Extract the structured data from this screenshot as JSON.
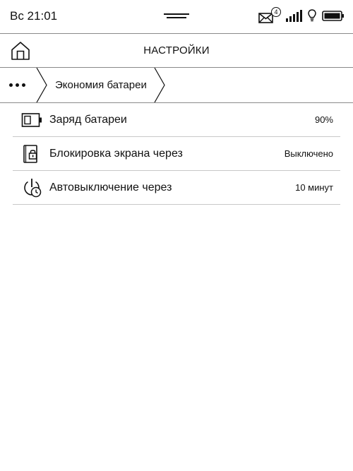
{
  "status_bar": {
    "time": "Вс 21:01",
    "mail_badge": "4",
    "icons": [
      "mail-icon",
      "signal-icon",
      "bulb-icon",
      "battery-icon"
    ]
  },
  "header": {
    "title": "НАСТРОЙКИ",
    "home_icon": "home-icon"
  },
  "breadcrumb": {
    "more_icon": "more-dots-icon",
    "current": "Экономия батареи"
  },
  "settings": [
    {
      "icon": "battery-icon",
      "label": "Заряд батареи",
      "value": "90%"
    },
    {
      "icon": "lock-screen-icon",
      "label": "Блокировка экрана через",
      "value": "Выключено"
    },
    {
      "icon": "power-timer-icon",
      "label": "Автовыключение через",
      "value": "10 минут"
    }
  ],
  "colors": {
    "background": "#ffffff",
    "text": "#111111",
    "divider": "#8a8a8a",
    "row_divider": "#c8c8c8"
  }
}
